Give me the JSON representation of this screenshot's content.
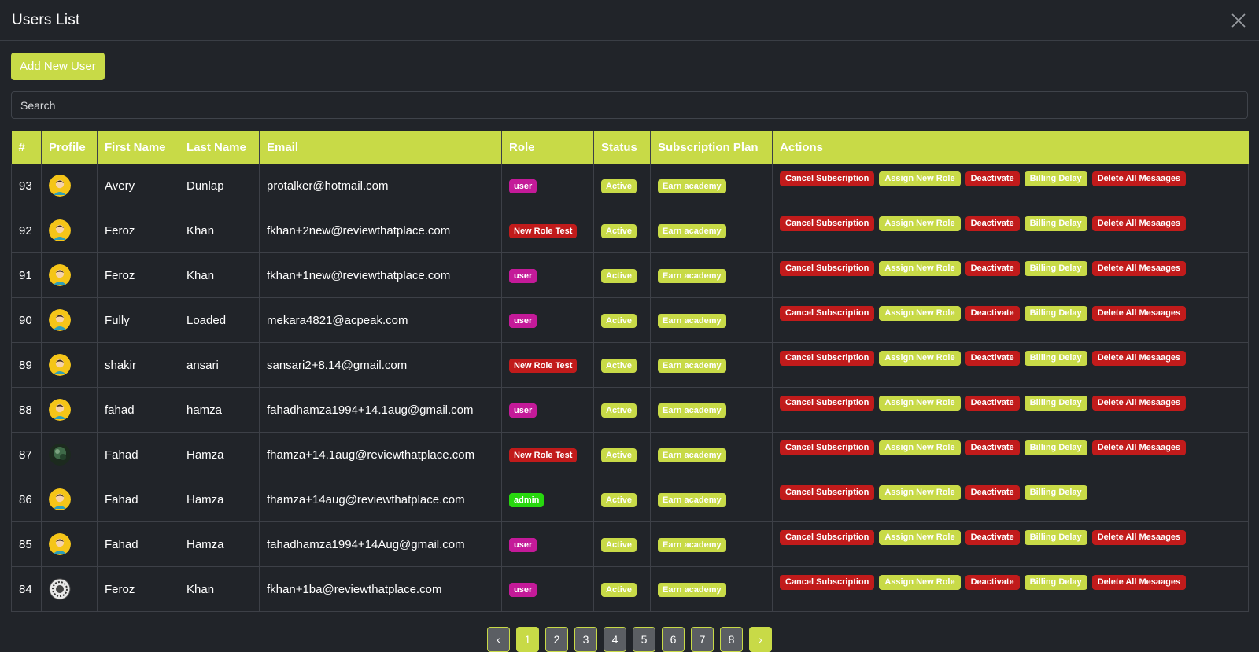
{
  "header": {
    "title": "Users List",
    "close_icon": "close-icon"
  },
  "toolbar": {
    "add_label": "Add New User"
  },
  "search": {
    "placeholder": "Search",
    "value": ""
  },
  "colors": {
    "accent": "#c8da47",
    "background": "#212429",
    "danger": "#c11b1b",
    "role_user": "#c41a99",
    "role_admin": "#27d80e"
  },
  "table": {
    "columns": [
      "#",
      "Profile",
      "First Name",
      "Last Name",
      "Email",
      "Role",
      "Status",
      "Subscription Plan",
      "Actions"
    ],
    "rows": [
      {
        "id": "93",
        "avatar": "emoji-avatar",
        "first": "Avery",
        "last": "Dunlap",
        "email": "protalker@hotmail.com",
        "role": "user",
        "status": "Active",
        "plan": "Earn academy",
        "actions": [
          "Cancel Subscription",
          "Assign New Role",
          "Deactivate",
          "Billing Delay",
          "Delete All Mesaages"
        ]
      },
      {
        "id": "92",
        "avatar": "emoji-avatar",
        "first": "Feroz",
        "last": "Khan",
        "email": "fkhan+2new@reviewthatplace.com",
        "role": "New Role Test",
        "status": "Active",
        "plan": "Earn academy",
        "actions": [
          "Cancel Subscription",
          "Assign New Role",
          "Deactivate",
          "Billing Delay",
          "Delete All Mesaages"
        ]
      },
      {
        "id": "91",
        "avatar": "emoji-avatar",
        "first": "Feroz",
        "last": "Khan",
        "email": "fkhan+1new@reviewthatplace.com",
        "role": "user",
        "status": "Active",
        "plan": "Earn academy",
        "actions": [
          "Cancel Subscription",
          "Assign New Role",
          "Deactivate",
          "Billing Delay",
          "Delete All Mesaages"
        ]
      },
      {
        "id": "90",
        "avatar": "emoji-avatar",
        "first": "Fully",
        "last": "Loaded",
        "email": "mekara4821@acpeak.com",
        "role": "user",
        "status": "Active",
        "plan": "Earn academy",
        "actions": [
          "Cancel Subscription",
          "Assign New Role",
          "Deactivate",
          "Billing Delay",
          "Delete All Mesaages"
        ]
      },
      {
        "id": "89",
        "avatar": "emoji-avatar",
        "first": "shakir",
        "last": "ansari",
        "email": "sansari2+8.14@gmail.com",
        "role": "New Role Test",
        "status": "Active",
        "plan": "Earn academy",
        "actions": [
          "Cancel Subscription",
          "Assign New Role",
          "Deactivate",
          "Billing Delay",
          "Delete All Mesaages"
        ]
      },
      {
        "id": "88",
        "avatar": "emoji-avatar",
        "first": "fahad",
        "last": "hamza",
        "email": "fahadhamza1994+14.1aug@gmail.com",
        "role": "user",
        "status": "Active",
        "plan": "Earn academy",
        "actions": [
          "Cancel Subscription",
          "Assign New Role",
          "Deactivate",
          "Billing Delay",
          "Delete All Mesaages"
        ]
      },
      {
        "id": "87",
        "avatar": "photo-avatar",
        "first": "Fahad",
        "last": "Hamza",
        "email": "fhamza+14.1aug@reviewthatplace.com",
        "role": "New Role Test",
        "status": "Active",
        "plan": "Earn academy",
        "actions": [
          "Cancel Subscription",
          "Assign New Role",
          "Deactivate",
          "Billing Delay",
          "Delete All Mesaages"
        ]
      },
      {
        "id": "86",
        "avatar": "emoji-avatar",
        "first": "Fahad",
        "last": "Hamza",
        "email": "fhamza+14aug@reviewthatplace.com",
        "role": "admin",
        "status": "Active",
        "plan": "Earn academy",
        "actions": [
          "Cancel Subscription",
          "Assign New Role",
          "Deactivate",
          "Billing Delay"
        ]
      },
      {
        "id": "85",
        "avatar": "emoji-avatar",
        "first": "Fahad",
        "last": "Hamza",
        "email": "fahadhamza1994+14Aug@gmail.com",
        "role": "user",
        "status": "Active",
        "plan": "Earn academy",
        "actions": [
          "Cancel Subscription",
          "Assign New Role",
          "Deactivate",
          "Billing Delay",
          "Delete All Mesaages"
        ]
      },
      {
        "id": "84",
        "avatar": "logo-avatar",
        "first": "Feroz",
        "last": "Khan",
        "email": "fkhan+1ba@reviewthatplace.com",
        "role": "user",
        "status": "Active",
        "plan": "Earn academy",
        "actions": [
          "Cancel Subscription",
          "Assign New Role",
          "Deactivate",
          "Billing Delay",
          "Delete All Mesaages"
        ]
      }
    ]
  },
  "pagination": {
    "prev": "‹",
    "next": "›",
    "pages": [
      "1",
      "2",
      "3",
      "4",
      "5",
      "6",
      "7",
      "8"
    ],
    "current": "1"
  }
}
